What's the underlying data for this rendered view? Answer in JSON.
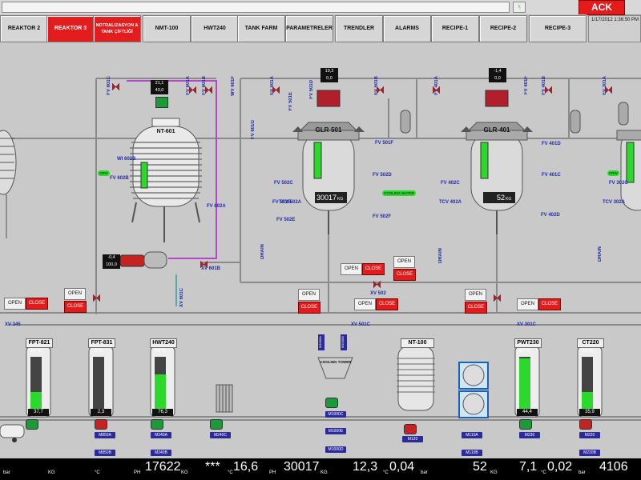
{
  "topbar": {
    "ack_label": "ACK",
    "flag_text": "ᛋ"
  },
  "nav": {
    "tabs": [
      {
        "label": "REAKTOR 2",
        "active": false
      },
      {
        "label": "REAKTOR 3",
        "active": true
      },
      {
        "label": "NOTRALIZASYON & TANK ÇİFTLİĞİ",
        "active": true
      },
      {
        "label": "NMT-100",
        "active": false
      },
      {
        "label": "HWT240",
        "active": false
      },
      {
        "label": "TANK FARM",
        "active": false
      },
      {
        "label": "PARAMETRELER",
        "active": false
      },
      {
        "label": "TRENDLER",
        "active": false
      },
      {
        "label": "ALARMS",
        "active": false
      },
      {
        "label": "RECIPE-1",
        "active": false
      },
      {
        "label": "RECIPE-2",
        "active": false
      },
      {
        "label": "RECIPE-3",
        "active": false
      }
    ],
    "datetime": "1/17/2012 1:36:50 PM"
  },
  "reactors": {
    "nt601": {
      "name": "NT-601",
      "setpoint": "21,1",
      "pv": "40,0",
      "temp_a": "-0,4",
      "temp_b": "100,0",
      "motor": "XV 601B"
    },
    "glr501": {
      "name": "GLR-501",
      "level": "30017",
      "unit": "KG",
      "top_a": "19,3",
      "top_b": "0,0",
      "valve": "XV 502"
    },
    "glr401": {
      "name": "GLR-401",
      "level": "52",
      "unit": "KG",
      "top_a": "-1,4",
      "top_b": "0,0"
    }
  },
  "valve_labels": [
    "FV 601C",
    "FV 601A",
    "FV 601B",
    "WV 601F",
    "FV 602B",
    "FV 602A",
    "WI 602B",
    "FV 601D",
    "XV 601B",
    "FV 601G",
    "XV 601C",
    "FV 501A",
    "FV 501B",
    "FV 501E",
    "FV 501D",
    "FV 501F",
    "FV 501G",
    "FV 502B",
    "FV 502C",
    "FV 502D",
    "FV 502E",
    "FV 502F",
    "TCV 502A",
    "XV 501C",
    "XV 501B",
    "FV 401A",
    "FV 401B",
    "FV 401C",
    "FV 401F",
    "FV 402B",
    "FV 402C",
    "FV 402D",
    "FV 402E",
    "FV 402F",
    "TCV 402A",
    "FV 401D",
    "FV 301A",
    "FV 301B",
    "FV 302C",
    "FV 302F",
    "TCV 302A",
    "XV 345",
    "XV 301C",
    "CRW",
    "CRW",
    "COOLING WATER",
    "DRAIN",
    "DRAIN",
    "DRAIN"
  ],
  "buttons": {
    "open": "OPEN",
    "close": "CLOSE"
  },
  "tanks": [
    {
      "name": "FPT-821",
      "pct": "14 %",
      "temp": "37,7",
      "unit": "°C",
      "motors": [
        "M850A",
        "M850B"
      ]
    },
    {
      "name": "FPT-831",
      "pct": "0 %",
      "temp": "2,3",
      "unit": "°C",
      "motors": []
    },
    {
      "name": "HWT240",
      "pct": "66 %",
      "temp": "76,3",
      "unit": "°C",
      "motors": [
        "M240A",
        "M240B"
      ]
    },
    {
      "name": "NT-100",
      "pct": "",
      "temp": "",
      "unit": "",
      "motors": [
        "M120"
      ]
    },
    {
      "name": "PWT230",
      "pct": "97 %",
      "temp": "44,4",
      "unit": "°C",
      "motors": [
        "M230"
      ]
    },
    {
      "name": "CT220",
      "pct": "33 %",
      "temp": "35,9",
      "unit": "°C",
      "motors": [
        "M220",
        "M220B"
      ]
    }
  ],
  "misc_motors": [
    "M240C",
    "M1000A",
    "M1000B",
    "M1000C",
    "M1000E",
    "M1000D",
    "M110A",
    "M110B"
  ],
  "cooling_tower": "COOLING TOWER",
  "bottom": [
    {
      "label": "bar",
      "value": ""
    },
    {
      "label": "KG",
      "value": ""
    },
    {
      "label": "°C",
      "value": ""
    },
    {
      "label": "PH",
      "value": ""
    },
    {
      "label": "KG",
      "value": "17622"
    },
    {
      "label": "°C",
      "value": "***"
    },
    {
      "label": "PH",
      "value": "16,6"
    },
    {
      "label": "KG",
      "value": "30017"
    },
    {
      "label": "°C",
      "value": "12,3"
    },
    {
      "label": "bar",
      "value": "0,04"
    },
    {
      "label": "KG",
      "value": "52"
    },
    {
      "label": "°C",
      "value": "7,1"
    },
    {
      "label": "bar",
      "value": "0,02"
    },
    {
      "label": "",
      "value": "4106"
    }
  ],
  "colors": {
    "active_tab": "#e31d1d",
    "ack": "#e41b1b",
    "fill_green": "#2bd82b",
    "pipe_purple": "#b248c7",
    "valve_red": "#b21e2a"
  }
}
